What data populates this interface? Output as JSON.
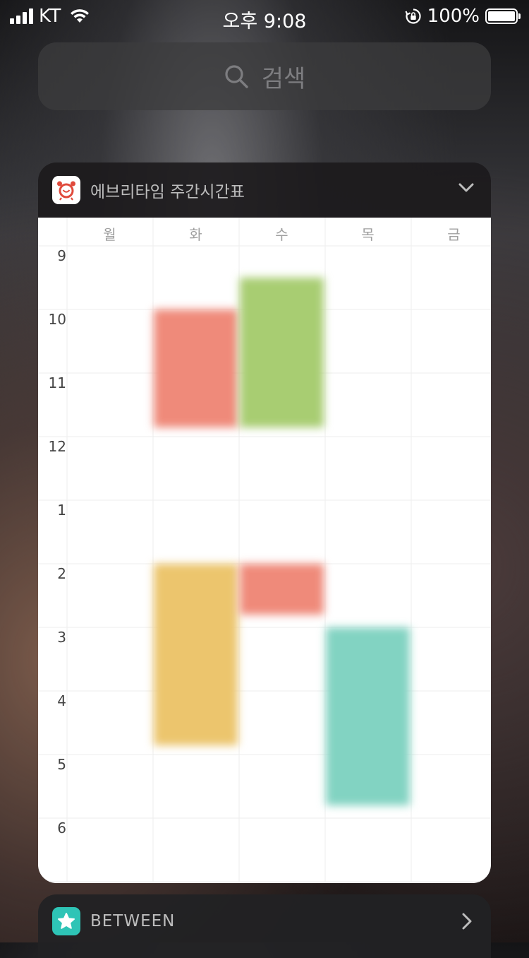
{
  "status_bar": {
    "carrier": "KT",
    "time": "오후 9:08",
    "battery": "100%",
    "battery_level": 100
  },
  "search": {
    "label": "검색",
    "icon": "search-icon"
  },
  "widget": {
    "title": "에브리타임 주간시간표",
    "icon": "alarm-clock-icon",
    "collapse_icon": "chevron-down-icon",
    "days": [
      "월",
      "화",
      "수",
      "목",
      "금"
    ],
    "hours": [
      "9",
      "10",
      "11",
      "12",
      "1",
      "2",
      "3",
      "4",
      "5",
      "6"
    ],
    "classes": [
      {
        "day": "화",
        "start": 10.0,
        "end": 11.85,
        "color": "#ef8a7a"
      },
      {
        "day": "수",
        "start": 9.5,
        "end": 11.85,
        "color": "#a8cd72"
      },
      {
        "day": "화",
        "start": 14.0,
        "end": 16.85,
        "color": "#ecc56d"
      },
      {
        "day": "수",
        "start": 14.0,
        "end": 14.8,
        "color": "#ef8a7a"
      },
      {
        "day": "목",
        "start": 15.0,
        "end": 17.8,
        "color": "#82d3c2"
      }
    ]
  },
  "next_widget": {
    "title": "BETWEEN",
    "icon": "star-icon",
    "expand_icon": "chevron-right-icon"
  }
}
